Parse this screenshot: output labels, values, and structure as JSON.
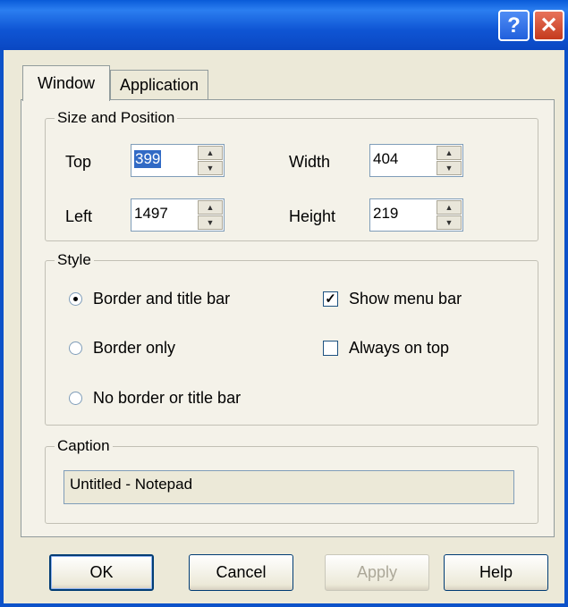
{
  "titlebar": {
    "help_label": "?",
    "close_label": "✕"
  },
  "tabs": [
    {
      "label": "Window",
      "active": true
    },
    {
      "label": "Application",
      "active": false
    }
  ],
  "size_position": {
    "label": "Size and Position",
    "top_label": "Top",
    "top_value": "399",
    "left_label": "Left",
    "left_value": "1497",
    "width_label": "Width",
    "width_value": "404",
    "height_label": "Height",
    "height_value": "219"
  },
  "style": {
    "label": "Style",
    "radios": [
      {
        "label": "Border and title bar",
        "checked": true
      },
      {
        "label": "Border only",
        "checked": false
      },
      {
        "label": "No border or title bar",
        "checked": false
      }
    ],
    "checks": [
      {
        "label": "Show menu bar",
        "checked": true
      },
      {
        "label": "Always on top",
        "checked": false
      }
    ]
  },
  "caption": {
    "label": "Caption",
    "value": "Untitled - Notepad"
  },
  "buttons": {
    "ok": "OK",
    "cancel": "Cancel",
    "apply": "Apply",
    "help": "Help"
  },
  "colors": {
    "titlebar": "#0a5bd8",
    "dialog_bg": "#ece9d8",
    "selection": "#316ac5",
    "close": "#c43a1e"
  }
}
